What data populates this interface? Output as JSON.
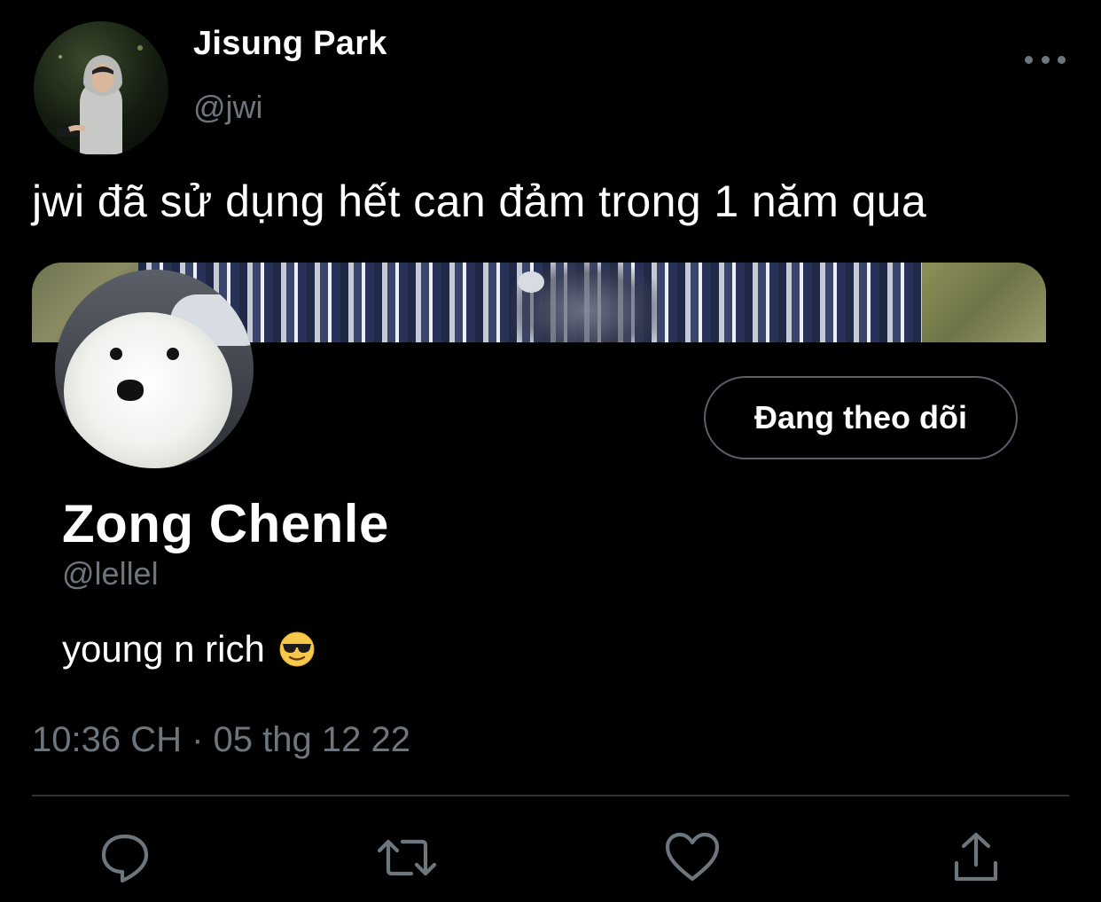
{
  "tweet": {
    "author": {
      "display_name": "Jisung Park",
      "handle": "@jwi"
    },
    "text": "jwi đã sử dụng hết can đảm trong 1 năm qua",
    "timestamp": "10:36 CH · 05 thg 12 22",
    "more_icon": "ellipsis-icon"
  },
  "profile_card": {
    "display_name": "Zong Chenle",
    "handle": "@lellel",
    "bio": "young n rich",
    "bio_emoji": "smiling-face-with-sunglasses-emoji",
    "follow_button_label": "Đang theo dõi"
  },
  "actions": [
    {
      "name": "reply",
      "icon": "reply-icon"
    },
    {
      "name": "retweet",
      "icon": "retweet-icon"
    },
    {
      "name": "like",
      "icon": "heart-icon"
    },
    {
      "name": "share",
      "icon": "share-icon"
    }
  ],
  "colors": {
    "background": "#000000",
    "primary_text": "#ffffff",
    "secondary_text": "#6e767d",
    "divider": "#2f3336",
    "button_border": "#56616b"
  }
}
